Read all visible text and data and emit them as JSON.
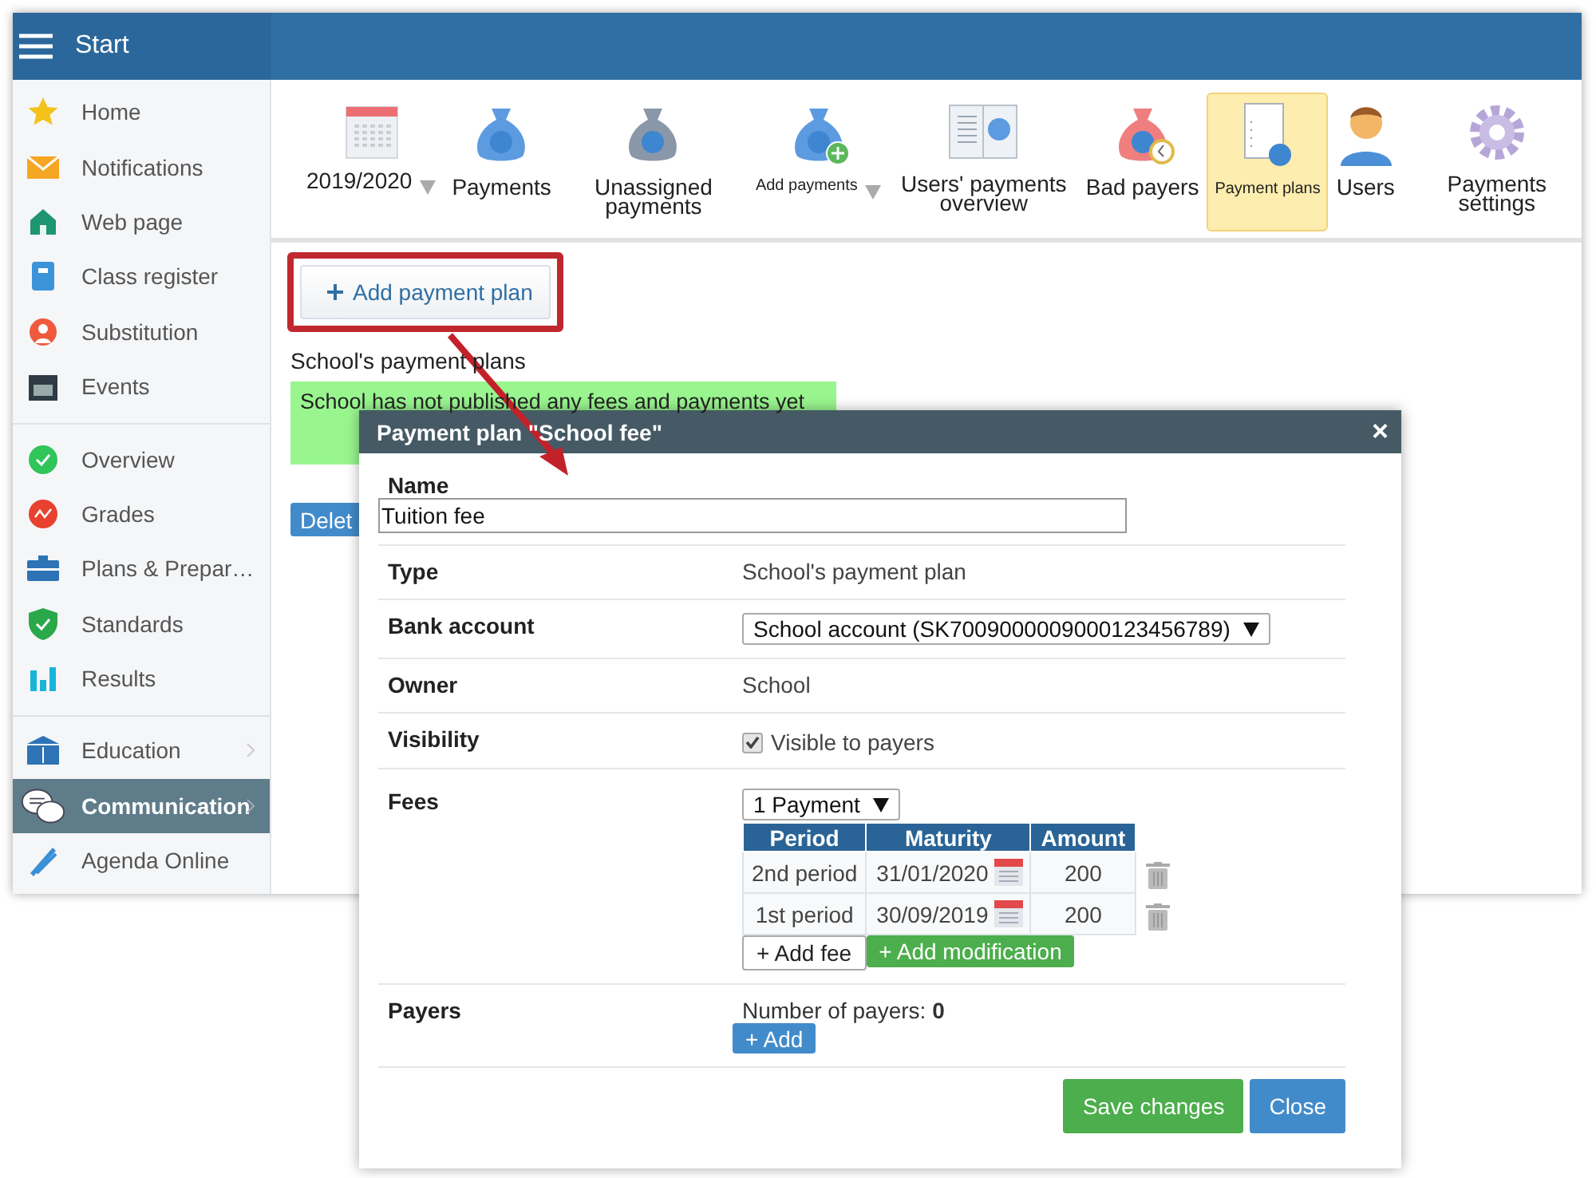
{
  "header": {
    "title": "Start"
  },
  "sidebar": {
    "groups": [
      [
        {
          "label": "Home",
          "selected": false,
          "submenu": false
        },
        {
          "label": "Notifications",
          "selected": false,
          "submenu": false
        },
        {
          "label": "Web page",
          "selected": false,
          "submenu": false
        },
        {
          "label": "Class register",
          "selected": false,
          "submenu": false
        },
        {
          "label": "Substitution",
          "selected": false,
          "submenu": false
        },
        {
          "label": "Events",
          "selected": false,
          "submenu": false
        }
      ],
      [
        {
          "label": "Overview",
          "selected": false,
          "submenu": false
        },
        {
          "label": "Grades",
          "selected": false,
          "submenu": false
        },
        {
          "label": "Plans & Prepar…",
          "selected": false,
          "submenu": false
        },
        {
          "label": "Standards",
          "selected": false,
          "submenu": false
        },
        {
          "label": "Results",
          "selected": false,
          "submenu": false
        }
      ],
      [
        {
          "label": "Education",
          "selected": false,
          "submenu": true
        },
        {
          "label": "Communication",
          "selected": true,
          "submenu": true
        },
        {
          "label": "Agenda Online",
          "selected": false,
          "submenu": false
        }
      ]
    ]
  },
  "toolbar": [
    {
      "label": "2019/2020",
      "selected": false,
      "dropdown": true,
      "small": false
    },
    {
      "label": "Payments",
      "selected": false,
      "dropdown": false,
      "small": false
    },
    {
      "label": "Unassigned payments",
      "selected": false,
      "dropdown": false,
      "small": false
    },
    {
      "label": "Add payments",
      "selected": false,
      "dropdown": true,
      "small": true
    },
    {
      "label": "Users' payments overview",
      "selected": false,
      "dropdown": false,
      "small": false
    },
    {
      "label": "Bad payers",
      "selected": false,
      "dropdown": false,
      "small": false
    },
    {
      "label": "Payment plans",
      "selected": true,
      "dropdown": false,
      "small": true
    },
    {
      "label": "Users",
      "selected": false,
      "dropdown": false,
      "small": false
    },
    {
      "label": "Payments settings",
      "selected": false,
      "dropdown": false,
      "small": false
    }
  ],
  "content": {
    "add_button": {
      "label": "Add payment plan",
      "highlighted": true
    },
    "section_title": "School's payment plans",
    "notice": "School has not published any fees and payments yet",
    "delete_button": "Delet"
  },
  "modal": {
    "title": "Payment plan \"School fee\"",
    "close": "×",
    "name": {
      "label": "Name",
      "value": "Tuition fee"
    },
    "rows": [
      {
        "kind": "text",
        "label": "Type",
        "value": "School's payment plan"
      },
      {
        "kind": "select",
        "label": "Bank account",
        "value": "School account (SK7009000009000123456789)"
      },
      {
        "kind": "text",
        "label": "Owner",
        "value": "School"
      },
      {
        "kind": "checkbox",
        "label": "Visibility",
        "value": "Visible to payers",
        "checked": true
      },
      {
        "kind": "fees",
        "label": "Fees",
        "select": "1 Payment",
        "columns": [
          "Period",
          "Maturity",
          "Amount"
        ],
        "fees": [
          {
            "period": "2nd period",
            "maturity": "31/01/2020",
            "amount": "200"
          },
          {
            "period": "1st period",
            "maturity": "30/09/2019",
            "amount": "200"
          }
        ],
        "add_fee": "+ Add fee",
        "add_modification": "+ Add modification"
      },
      {
        "kind": "payers",
        "label": "Payers",
        "text": "Number of payers:",
        "count": "0",
        "button": "+ Add"
      }
    ],
    "buttons": [
      {
        "label": "Save changes",
        "kind": "success"
      },
      {
        "label": "Close",
        "kind": "primary"
      }
    ]
  }
}
